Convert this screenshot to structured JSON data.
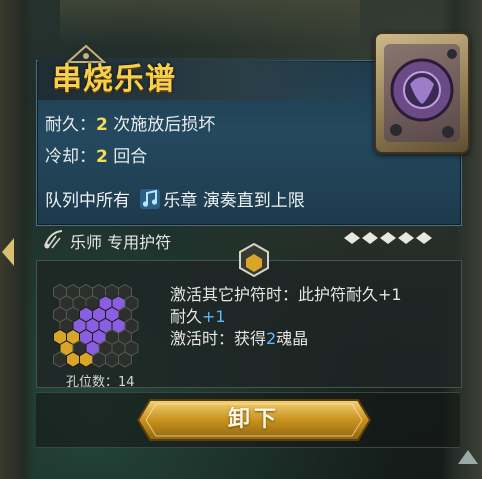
{
  "item": {
    "title": "串烧乐谱",
    "durability_label": "耐久：",
    "durability_value": "2",
    "durability_suffix": "次施放后损坏",
    "cooldown_label": "冷却：",
    "cooldown_value": "2",
    "cooldown_suffix": "回合",
    "effect_prefix": "队列中所有",
    "effect_keyword": "乐章",
    "effect_suffix": "演奏直到上限",
    "class_label": "乐师 专用护符",
    "quality_icon_count": 5
  },
  "details": {
    "line1": "激活其它护符时：此护符耐久+1",
    "line2_prefix": "耐久",
    "line2_value": "+1",
    "line3_prefix": "激活时：获得",
    "line3_value": "2",
    "line3_suffix": "魂晶",
    "slot_count_label": "孔位数：14"
  },
  "actions": {
    "unequip_label": "卸下"
  },
  "colors": {
    "title": "#f6d04a",
    "highlight_number": "#f4de58",
    "blue_value": "#5fb7ff",
    "purple_slot": "#8a5ee0",
    "gold_slot": "#d9a526"
  }
}
